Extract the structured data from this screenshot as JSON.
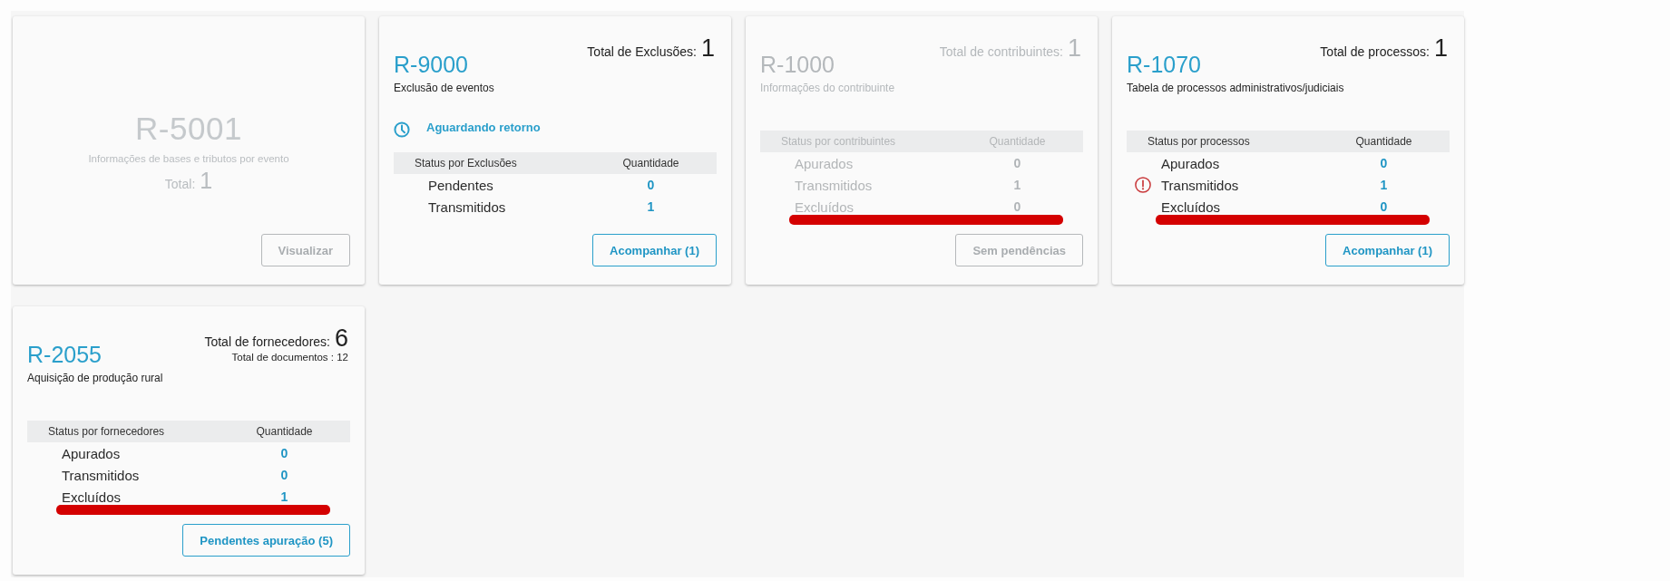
{
  "cards": [
    {
      "kind": "summary",
      "disabled": true,
      "code": "R-5001",
      "description": "Informações de bases e tributos por evento",
      "total": {
        "label": "Total:",
        "value": "1"
      },
      "button": "Visualizar"
    },
    {
      "kind": "status",
      "disabled": false,
      "code": "R-9000",
      "description": "Exclusão de eventos",
      "total": {
        "label": "Total de Exclusões:",
        "value": "1"
      },
      "status": "Aguardando retorno",
      "table": {
        "columns": [
          "Status por Exclusões",
          "Quantidade"
        ],
        "rows": [
          {
            "label": "Pendentes",
            "value": "0",
            "alert": false,
            "underlined": false
          },
          {
            "label": "Transmitidos",
            "value": "1",
            "alert": false,
            "underlined": false
          }
        ]
      },
      "button": "Acompanhar (1)"
    },
    {
      "kind": "status",
      "disabled": true,
      "code": "R-1000",
      "description": "Informações do contribuinte",
      "total": {
        "label": "Total de contribuintes:",
        "value": "1"
      },
      "table": {
        "columns": [
          "Status por contribuintes",
          "Quantidade"
        ],
        "rows": [
          {
            "label": "Apurados",
            "value": "0",
            "alert": false,
            "underlined": false
          },
          {
            "label": "Transmitidos",
            "value": "1",
            "alert": false,
            "underlined": false
          },
          {
            "label": "Excluídos",
            "value": "0",
            "alert": false,
            "underlined": true
          }
        ]
      },
      "button": "Sem pendências"
    },
    {
      "kind": "status",
      "disabled": false,
      "code": "R-1070",
      "description": "Tabela de processos administrativos/judiciais",
      "total": {
        "label": "Total de processos:",
        "value": "1"
      },
      "table": {
        "columns": [
          "Status por processos",
          "Quantidade"
        ],
        "rows": [
          {
            "label": "Apurados",
            "value": "0",
            "alert": false,
            "underlined": false
          },
          {
            "label": "Transmitidos",
            "value": "1",
            "alert": true,
            "underlined": false
          },
          {
            "label": "Excluídos",
            "value": "0",
            "alert": false,
            "underlined": true
          }
        ]
      },
      "button": "Acompanhar (1)"
    },
    {
      "kind": "status",
      "disabled": false,
      "code": "R-2055",
      "description": "Aquisição de produção rural",
      "total": {
        "label": "Total de fornecedores:",
        "value": "6"
      },
      "subtotal": "Total de documentos : 12",
      "table": {
        "columns": [
          "Status por fornecedores",
          "Quantidade"
        ],
        "rows": [
          {
            "label": "Apurados",
            "value": "0",
            "alert": false,
            "underlined": false
          },
          {
            "label": "Transmitidos",
            "value": "0",
            "alert": false,
            "underlined": false
          },
          {
            "label": "Excluídos",
            "value": "1",
            "alert": false,
            "underlined": true
          }
        ]
      },
      "button": "Pendentes apuração (5)"
    }
  ]
}
